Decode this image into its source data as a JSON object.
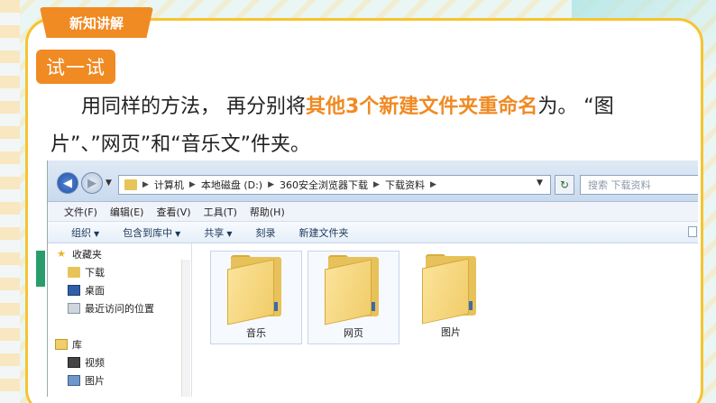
{
  "slide": {
    "section_tab": "新知讲解",
    "try_badge": "试一试",
    "instruction_part1": "用同样的方法， 再分别将",
    "instruction_highlight": "其他3个新建文件夹重命名",
    "instruction_part2": "为。 “图片”、”网页”和“音乐文”件夹。",
    "accent_color": "#f08a23",
    "border_color": "#f6c431"
  },
  "explorer": {
    "nav": {
      "back_icon": "back-arrow-icon",
      "forward_icon": "forward-arrow-icon"
    },
    "breadcrumbs": [
      "计算机",
      "本地磁盘 (D:)",
      "360安全浏览器下载",
      "下载资料"
    ],
    "search_placeholder": "搜索 下载资料",
    "menu": [
      "文件(F)",
      "编辑(E)",
      "查看(V)",
      "工具(T)",
      "帮助(H)"
    ],
    "toolbar": {
      "organize": "组织",
      "include_library": "包含到库中",
      "share": "共享",
      "burn": "刻录",
      "new_folder": "新建文件夹"
    },
    "navpane": {
      "favorites": "收藏夹",
      "downloads": "下载",
      "desktop": "桌面",
      "recent": "最近访问的位置",
      "library": "库",
      "videos": "视频",
      "pictures": "图片"
    },
    "folders": [
      {
        "label": "音乐"
      },
      {
        "label": "网页"
      },
      {
        "label": "图片"
      }
    ]
  }
}
